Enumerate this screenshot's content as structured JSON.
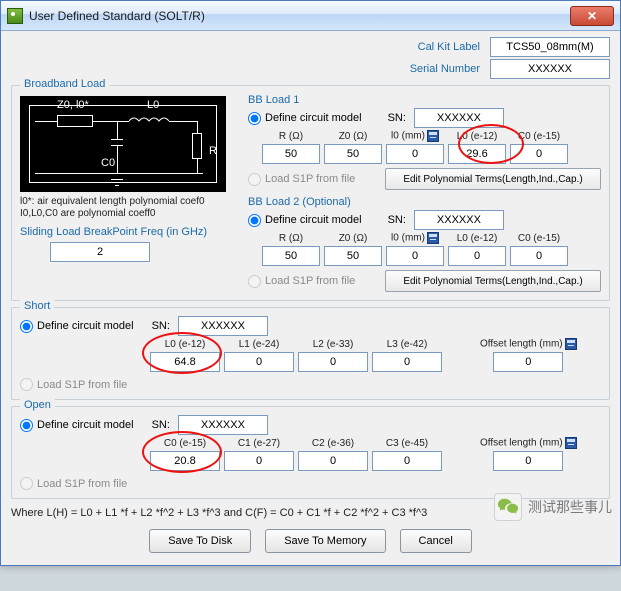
{
  "titlebar": {
    "title": "User Defined Standard (SOLT/R)"
  },
  "header": {
    "cal_kit_label_lab": "Cal Kit Label",
    "cal_kit_label_val": "TCS50_08mm(M)",
    "serial_lab": "Serial Number",
    "serial_val": "XXXXXX"
  },
  "broadband": {
    "legend": "Broadband Load",
    "diagram": {
      "z0": "Z0, l0*",
      "l0": "L0",
      "c0": "C0",
      "r": "R"
    },
    "note1": "l0*: air equivalent length polynomial coef0",
    "note2": "I0,L0,C0 are polynomial coeff0",
    "sliding_lab": "Sliding Load BreakPoint Freq (in GHz)",
    "sliding_val": "2"
  },
  "bb1": {
    "title": "BB Load 1",
    "define": "Define circuit model",
    "sn_lab": "SN:",
    "sn_val": "XXXXXX",
    "cols": {
      "r": "R (Ω)",
      "z0": "Z0 (Ω)",
      "l0mm": "l0 (mm)",
      "L0": "L0 (e-12)",
      "C0": "C0 (e-15)"
    },
    "vals": {
      "r": "50",
      "z0": "50",
      "l0mm": "0",
      "L0": "29.6",
      "C0": "0"
    },
    "load_s1p": "Load S1P from file",
    "edit_btn": "Edit Polynomial Terms(Length,Ind.,Cap.)"
  },
  "bb2": {
    "title": "BB Load 2 (Optional)",
    "define": "Define circuit model",
    "sn_lab": "SN:",
    "sn_val": "XXXXXX",
    "cols": {
      "r": "R (Ω)",
      "z0": "Z0 (Ω)",
      "l0mm": "l0 (mm)",
      "L0": "L0 (e-12)",
      "C0": "C0 (e-15)"
    },
    "vals": {
      "r": "50",
      "z0": "50",
      "l0mm": "0",
      "L0": "0",
      "C0": "0"
    },
    "load_s1p": "Load S1P from file",
    "edit_btn": "Edit Polynomial Terms(Length,Ind.,Cap.)"
  },
  "short": {
    "legend": "Short",
    "define": "Define circuit model",
    "sn_lab": "SN:",
    "sn_val": "XXXXXX",
    "cols": {
      "L0": "L0 (e-12)",
      "L1": "L1 (e-24)",
      "L2": "L2 (e-33)",
      "L3": "L3 (e-42)",
      "off": "Offset length (mm)"
    },
    "vals": {
      "L0": "64.8",
      "L1": "0",
      "L2": "0",
      "L3": "0",
      "off": "0"
    },
    "load_s1p": "Load S1P from file"
  },
  "open": {
    "legend": "Open",
    "define": "Define circuit model",
    "sn_lab": "SN:",
    "sn_val": "XXXXXX",
    "cols": {
      "C0": "C0 (e-15)",
      "C1": "C1 (e-27)",
      "C2": "C2 (e-36)",
      "C3": "C3 (e-45)",
      "off": "Offset length (mm)"
    },
    "vals": {
      "C0": "20.8",
      "C1": "0",
      "C2": "0",
      "C3": "0",
      "off": "0"
    },
    "load_s1p": "Load S1P from file"
  },
  "formula": "Where L(H) = L0 + L1 *f + L2 *f^2 + L3 *f^3  and  C(F) = C0 + C1 *f + C2 *f^2 + C3 *f^3",
  "buttons": {
    "save_disk": "Save To Disk",
    "save_mem": "Save To Memory",
    "cancel": "Cancel"
  },
  "watermark": "测试那些事儿"
}
